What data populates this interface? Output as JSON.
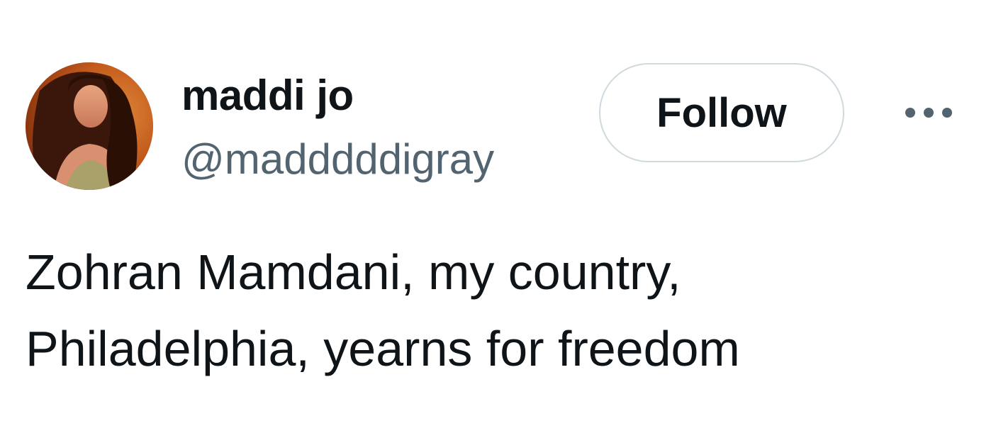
{
  "user": {
    "display_name": "maddi jo",
    "handle": "@madddddigray",
    "avatar_icon": "profile-photo"
  },
  "actions": {
    "follow_label": "Follow",
    "more_icon": "more-options-icon"
  },
  "tweet": {
    "lines": [
      "Zohran Mamdani, my country,",
      "Philadelphia, yearns for freedom"
    ]
  },
  "colors": {
    "text_primary": "#0f1419",
    "text_secondary": "#536471",
    "border": "#cfd9de",
    "background": "#ffffff"
  }
}
